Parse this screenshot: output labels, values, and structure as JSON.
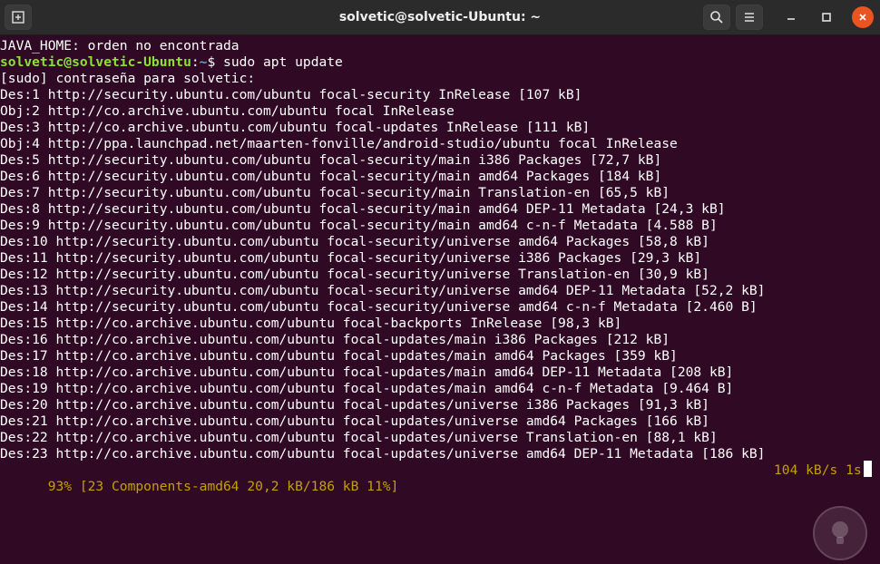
{
  "window": {
    "title": "solvetic@solvetic-Ubuntu: ~"
  },
  "icons": {
    "new_tab": "new-tab-icon",
    "search": "search-icon",
    "menu": "hamburger-menu-icon",
    "minimize": "minimize-icon",
    "maximize": "maximize-icon",
    "close": "close-icon",
    "watermark": "solvetic-logo-icon"
  },
  "colors": {
    "background": "#300a24",
    "titlebar": "#2b2b2b",
    "prompt_user": "#8ae234",
    "prompt_path": "#729fcf",
    "progress": "#c4a000",
    "close_button": "#e95420"
  },
  "terminal": {
    "line0": "JAVA_HOME: orden no encontrada",
    "prompt": {
      "user_host": "solvetic@solvetic-Ubuntu",
      "sep": ":",
      "path": "~",
      "symbol": "$ ",
      "command": "sudo apt update"
    },
    "line2": "[sudo] contraseña para solvetic:",
    "lines": [
      "Des:1 http://security.ubuntu.com/ubuntu focal-security InRelease [107 kB]",
      "Obj:2 http://co.archive.ubuntu.com/ubuntu focal InRelease",
      "Des:3 http://co.archive.ubuntu.com/ubuntu focal-updates InRelease [111 kB]",
      "Obj:4 http://ppa.launchpad.net/maarten-fonville/android-studio/ubuntu focal InRelease",
      "Des:5 http://security.ubuntu.com/ubuntu focal-security/main i386 Packages [72,7 kB]",
      "Des:6 http://security.ubuntu.com/ubuntu focal-security/main amd64 Packages [184 kB]",
      "Des:7 http://security.ubuntu.com/ubuntu focal-security/main Translation-en [65,5 kB]",
      "Des:8 http://security.ubuntu.com/ubuntu focal-security/main amd64 DEP-11 Metadata [24,3 kB]",
      "Des:9 http://security.ubuntu.com/ubuntu focal-security/main amd64 c-n-f Metadata [4.588 B]",
      "Des:10 http://security.ubuntu.com/ubuntu focal-security/universe amd64 Packages [58,8 kB]",
      "Des:11 http://security.ubuntu.com/ubuntu focal-security/universe i386 Packages [29,3 kB]",
      "Des:12 http://security.ubuntu.com/ubuntu focal-security/universe Translation-en [30,9 kB]",
      "Des:13 http://security.ubuntu.com/ubuntu focal-security/universe amd64 DEP-11 Metadata [52,2 kB]",
      "Des:14 http://security.ubuntu.com/ubuntu focal-security/universe amd64 c-n-f Metadata [2.460 B]",
      "Des:15 http://co.archive.ubuntu.com/ubuntu focal-backports InRelease [98,3 kB]",
      "Des:16 http://co.archive.ubuntu.com/ubuntu focal-updates/main i386 Packages [212 kB]",
      "Des:17 http://co.archive.ubuntu.com/ubuntu focal-updates/main amd64 Packages [359 kB]",
      "Des:18 http://co.archive.ubuntu.com/ubuntu focal-updates/main amd64 DEP-11 Metadata [208 kB]",
      "Des:19 http://co.archive.ubuntu.com/ubuntu focal-updates/main amd64 c-n-f Metadata [9.464 B]",
      "Des:20 http://co.archive.ubuntu.com/ubuntu focal-updates/universe i386 Packages [91,3 kB]",
      "Des:21 http://co.archive.ubuntu.com/ubuntu focal-updates/universe amd64 Packages [166 kB]",
      "Des:22 http://co.archive.ubuntu.com/ubuntu focal-updates/universe Translation-en [88,1 kB]",
      "Des:23 http://co.archive.ubuntu.com/ubuntu focal-updates/universe amd64 DEP-11 Metadata [186 kB]"
    ],
    "progress_left": "93% [23 Components-amd64 20,2 kB/186 kB 11%]",
    "progress_right": "104 kB/s 1s"
  }
}
